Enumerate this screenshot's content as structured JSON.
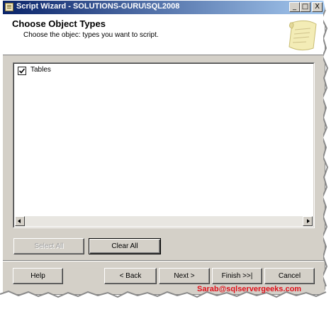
{
  "window": {
    "title": "Script Wizard - SOLUTIONS-GURU\\SQL2008",
    "controls": {
      "minimize": "_",
      "maximize": "□",
      "close": "X"
    }
  },
  "header": {
    "title": "Choose Object Types",
    "subtitle": "Choose the objec: types you want to script."
  },
  "object_types": [
    {
      "label": "Tables",
      "checked": true
    }
  ],
  "list_actions": {
    "select_all": "Select All",
    "clear_all": "Clear All"
  },
  "footer": {
    "help": "Help",
    "back": "< Back",
    "next": "Next >",
    "finish": "Finish >>|",
    "cancel": "Cancel"
  },
  "watermark": "Sarab@sqlservergeeks.com",
  "colors": {
    "titlebar_start": "#0a246a",
    "titlebar_end": "#a6caf0",
    "dialog_bg": "#d4d0c8",
    "watermark": "#e0101a"
  },
  "icons": {
    "title": "script-wizard-icon",
    "header_art": "scroll-paper-icon",
    "check": "checkmark-icon"
  }
}
